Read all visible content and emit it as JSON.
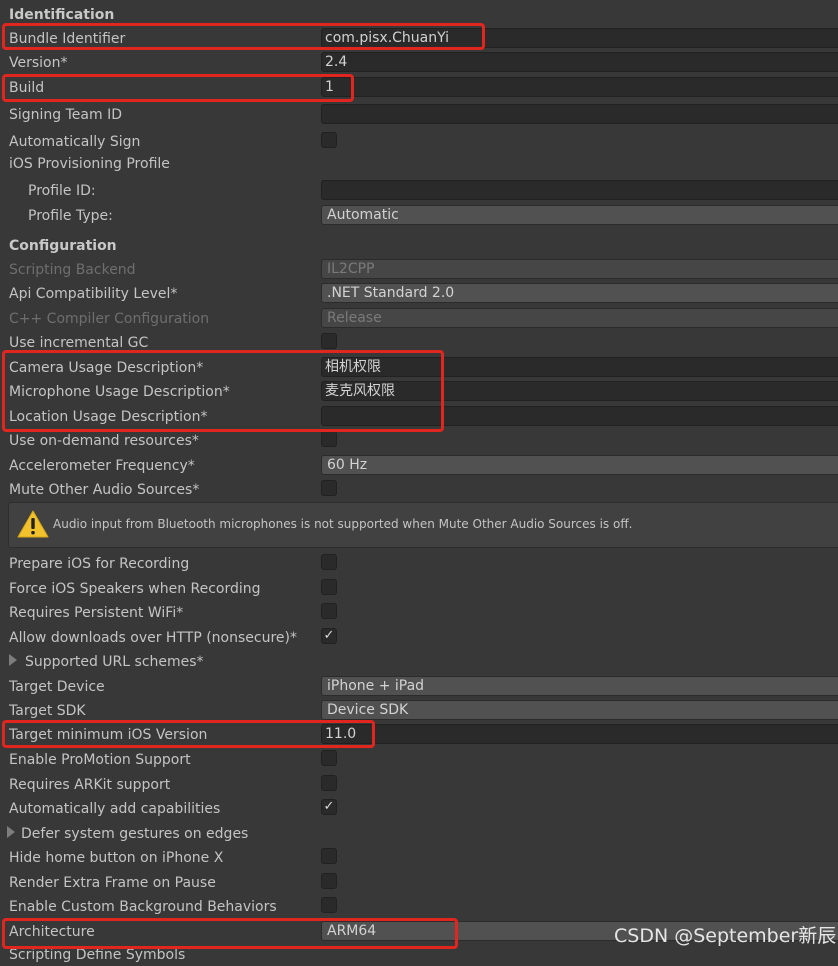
{
  "sections": {
    "identification": "Identification",
    "configuration": "Configuration"
  },
  "identification": {
    "bundle_identifier": {
      "label": "Bundle Identifier",
      "value": "com.pisx.ChuanYi"
    },
    "version": {
      "label": "Version*",
      "value": "2.4"
    },
    "build": {
      "label": "Build",
      "value": "1"
    },
    "signing_team_id": {
      "label": "Signing Team ID",
      "value": ""
    },
    "automatically_sign": {
      "label": "Automatically Sign",
      "checked": false
    },
    "ios_provisioning_profile": "iOS Provisioning Profile",
    "profile_id": {
      "label": "Profile ID:",
      "value": ""
    },
    "profile_type": {
      "label": "Profile Type:",
      "value": "Automatic"
    }
  },
  "configuration": {
    "scripting_backend": {
      "label": "Scripting Backend",
      "value": "IL2CPP"
    },
    "api_compat": {
      "label": "Api Compatibility Level*",
      "value": ".NET Standard 2.0"
    },
    "cpp_compiler": {
      "label": "C++ Compiler Configuration",
      "value": "Release"
    },
    "incremental_gc": {
      "label": "Use incremental GC",
      "checked": false
    },
    "camera_usage": {
      "label": "Camera Usage Description*",
      "value": "相机权限"
    },
    "microphone_usage": {
      "label": "Microphone Usage Description*",
      "value": "麦克风权限"
    },
    "location_usage": {
      "label": "Location Usage Description*",
      "value": ""
    },
    "on_demand": {
      "label": "Use on-demand resources*",
      "checked": false
    },
    "accelerometer": {
      "label": "Accelerometer Frequency*",
      "value": "60 Hz"
    },
    "mute_audio": {
      "label": "Mute Other Audio Sources*",
      "checked": false
    },
    "warning": "Audio input from Bluetooth microphones is not supported when Mute Other Audio Sources is off.",
    "prepare_recording": {
      "label": "Prepare iOS for Recording",
      "checked": false
    },
    "force_speakers": {
      "label": "Force iOS Speakers when Recording",
      "checked": false
    },
    "persistent_wifi": {
      "label": "Requires Persistent WiFi*",
      "checked": false
    },
    "allow_http": {
      "label": "Allow downloads over HTTP (nonsecure)*",
      "checked": true
    },
    "url_schemes": "Supported URL schemes*",
    "target_device": {
      "label": "Target Device",
      "value": "iPhone + iPad"
    },
    "target_sdk": {
      "label": "Target SDK",
      "value": "Device SDK"
    },
    "min_ios": {
      "label": "Target minimum iOS Version",
      "value": "11.0"
    },
    "promotion": {
      "label": "Enable ProMotion Support",
      "checked": false
    },
    "arkit": {
      "label": "Requires ARKit support",
      "checked": false
    },
    "auto_capabilities": {
      "label": "Automatically add capabilities",
      "checked": true
    },
    "defer_gestures": "Defer system gestures on edges",
    "hide_home": {
      "label": "Hide home button on iPhone X",
      "checked": false
    },
    "extra_frame": {
      "label": "Render Extra Frame on Pause",
      "checked": false
    },
    "custom_bg": {
      "label": "Enable Custom Background Behaviors",
      "checked": false
    },
    "architecture": {
      "label": "Architecture",
      "value": "ARM64"
    },
    "scripting_define": "Scripting Define Symbols"
  },
  "checkmark_glyph": "✓",
  "watermark": "CSDN @September新辰",
  "colors": {
    "highlight": "#e0261e",
    "background": "#383838",
    "warning_icon": "#f2c12e"
  },
  "icons": {
    "warning": "warning-triangle-icon",
    "foldout": "foldout-arrow-icon"
  }
}
